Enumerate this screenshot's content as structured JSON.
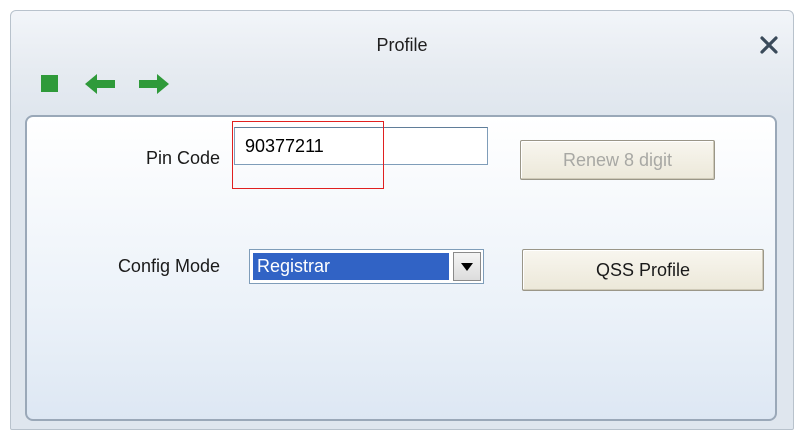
{
  "window": {
    "title": "Profile"
  },
  "toolbar": {
    "icons": [
      "stop-icon",
      "back-arrow-icon",
      "forward-arrow-icon"
    ]
  },
  "form": {
    "pin_code_label": "Pin Code",
    "pin_code_value": "90377211",
    "renew_button_label": "Renew 8 digit",
    "config_mode_label": "Config Mode",
    "config_mode_value": "Registrar",
    "qss_button_label": "QSS Profile"
  },
  "colors": {
    "toolbar_icon": "#2f9a3a",
    "selection": "#3163c5",
    "highlight_box": "#e02020"
  }
}
